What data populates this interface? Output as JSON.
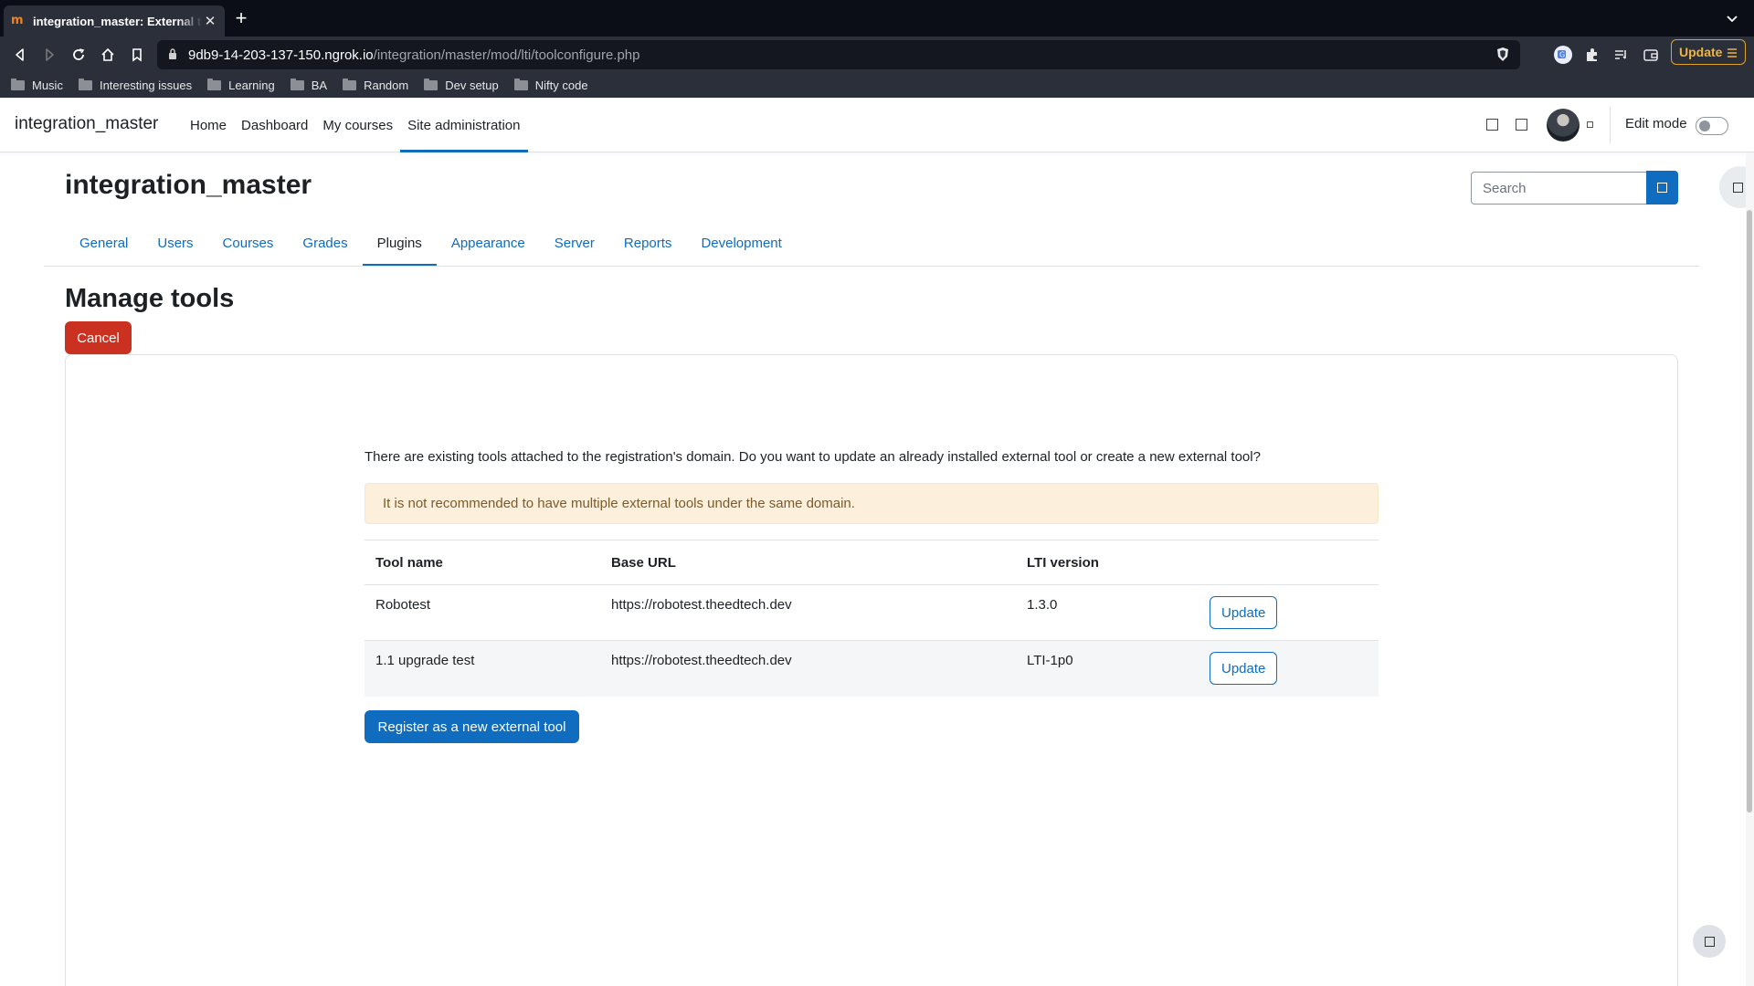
{
  "browser": {
    "tab_title": "integration_master: External tool",
    "tab_close": "✕",
    "new_tab": "+",
    "url_host": "9db9-14-203-137-150.ngrok.io",
    "url_path": "/integration/master/mod/lti/toolconfigure.php",
    "update_label": "Update",
    "bookmarks": [
      "Music",
      "Interesting issues",
      "Learning",
      "BA",
      "Random",
      "Dev setup",
      "Nifty code"
    ]
  },
  "navbar": {
    "site_name": "integration_master",
    "items": [
      "Home",
      "Dashboard",
      "My courses",
      "Site administration"
    ],
    "active_item": "Site administration",
    "edit_mode_label": "Edit mode"
  },
  "page": {
    "heading": "integration_master",
    "search_placeholder": "Search",
    "secondary_nav": [
      "General",
      "Users",
      "Courses",
      "Grades",
      "Plugins",
      "Appearance",
      "Server",
      "Reports",
      "Development"
    ],
    "active_secondary": "Plugins",
    "section_title": "Manage tools",
    "cancel_label": "Cancel"
  },
  "content": {
    "intro": "There are existing tools attached to the registration's domain. Do you want to update an already installed external tool or create a new external tool?",
    "warning": "It is not recommended to have multiple external tools under the same domain.",
    "table": {
      "headers": [
        "Tool name",
        "Base URL",
        "LTI version"
      ],
      "rows": [
        {
          "name": "Robotest",
          "url": "https://robotest.theedtech.dev",
          "version": "1.3.0",
          "action": "Update"
        },
        {
          "name": "1.1 upgrade test",
          "url": "https://robotest.theedtech.dev",
          "version": "LTI-1p0",
          "action": "Update"
        }
      ]
    },
    "register_label": "Register as a new external tool"
  },
  "colors": {
    "primary": "#0f6cbf",
    "danger": "#ca3120",
    "warning_bg": "#fcefdc",
    "warning_text": "#7d5a29",
    "browser_toolbar": "#2b2f3a",
    "browser_update_accent": "#e0a526"
  }
}
